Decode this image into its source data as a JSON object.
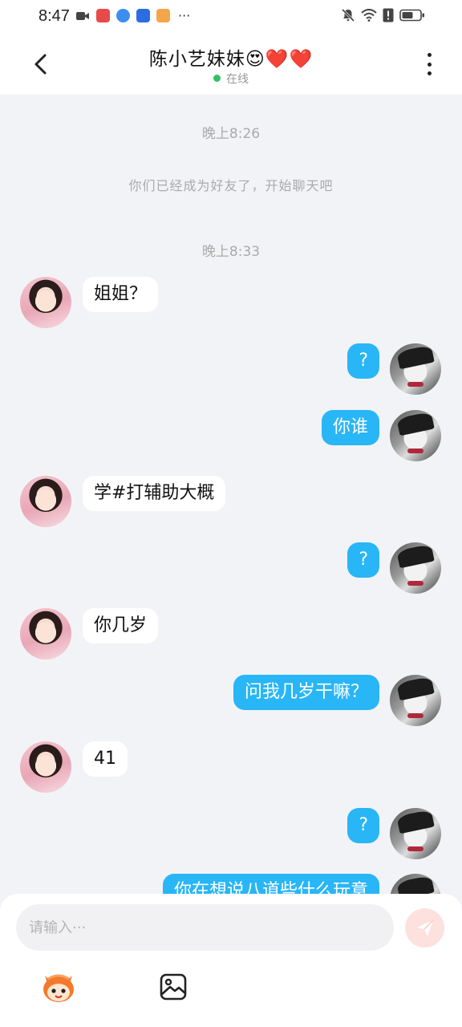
{
  "status_bar": {
    "time": "8:47",
    "more": "···"
  },
  "header": {
    "title": "陈小艺妹妹😍❤️❤️",
    "online_status": "在线"
  },
  "chat": {
    "timestamps": [
      "晚上8:26",
      "晚上8:33"
    ],
    "system_message": "你们已经成为好友了，开始聊天吧",
    "messages": [
      {
        "side": "in",
        "text": "姐姐？"
      },
      {
        "side": "out",
        "text": "?"
      },
      {
        "side": "out",
        "text": "你谁"
      },
      {
        "side": "in",
        "text": "学#打辅助大概"
      },
      {
        "side": "out",
        "text": "?"
      },
      {
        "side": "in",
        "text": "你几岁"
      },
      {
        "side": "out",
        "text": "问我几岁干嘛？"
      },
      {
        "side": "in",
        "text": "41"
      },
      {
        "side": "out",
        "text": "?"
      },
      {
        "side": "out",
        "text": "你在想说八道些什么玩意"
      }
    ]
  },
  "input": {
    "placeholder": "请输入···",
    "value": ""
  },
  "colors": {
    "outgoing_bubble": "#29b6f6",
    "incoming_bubble": "#ffffff",
    "chat_background": "#f2f3f7",
    "online_dot": "#2ec262",
    "send_button": "#fde1df"
  },
  "icons": [
    "back-arrow-icon",
    "more-dots-icon",
    "send-icon",
    "mascot-icon",
    "image-icon",
    "wifi-icon",
    "battery-icon",
    "mute-icon"
  ]
}
